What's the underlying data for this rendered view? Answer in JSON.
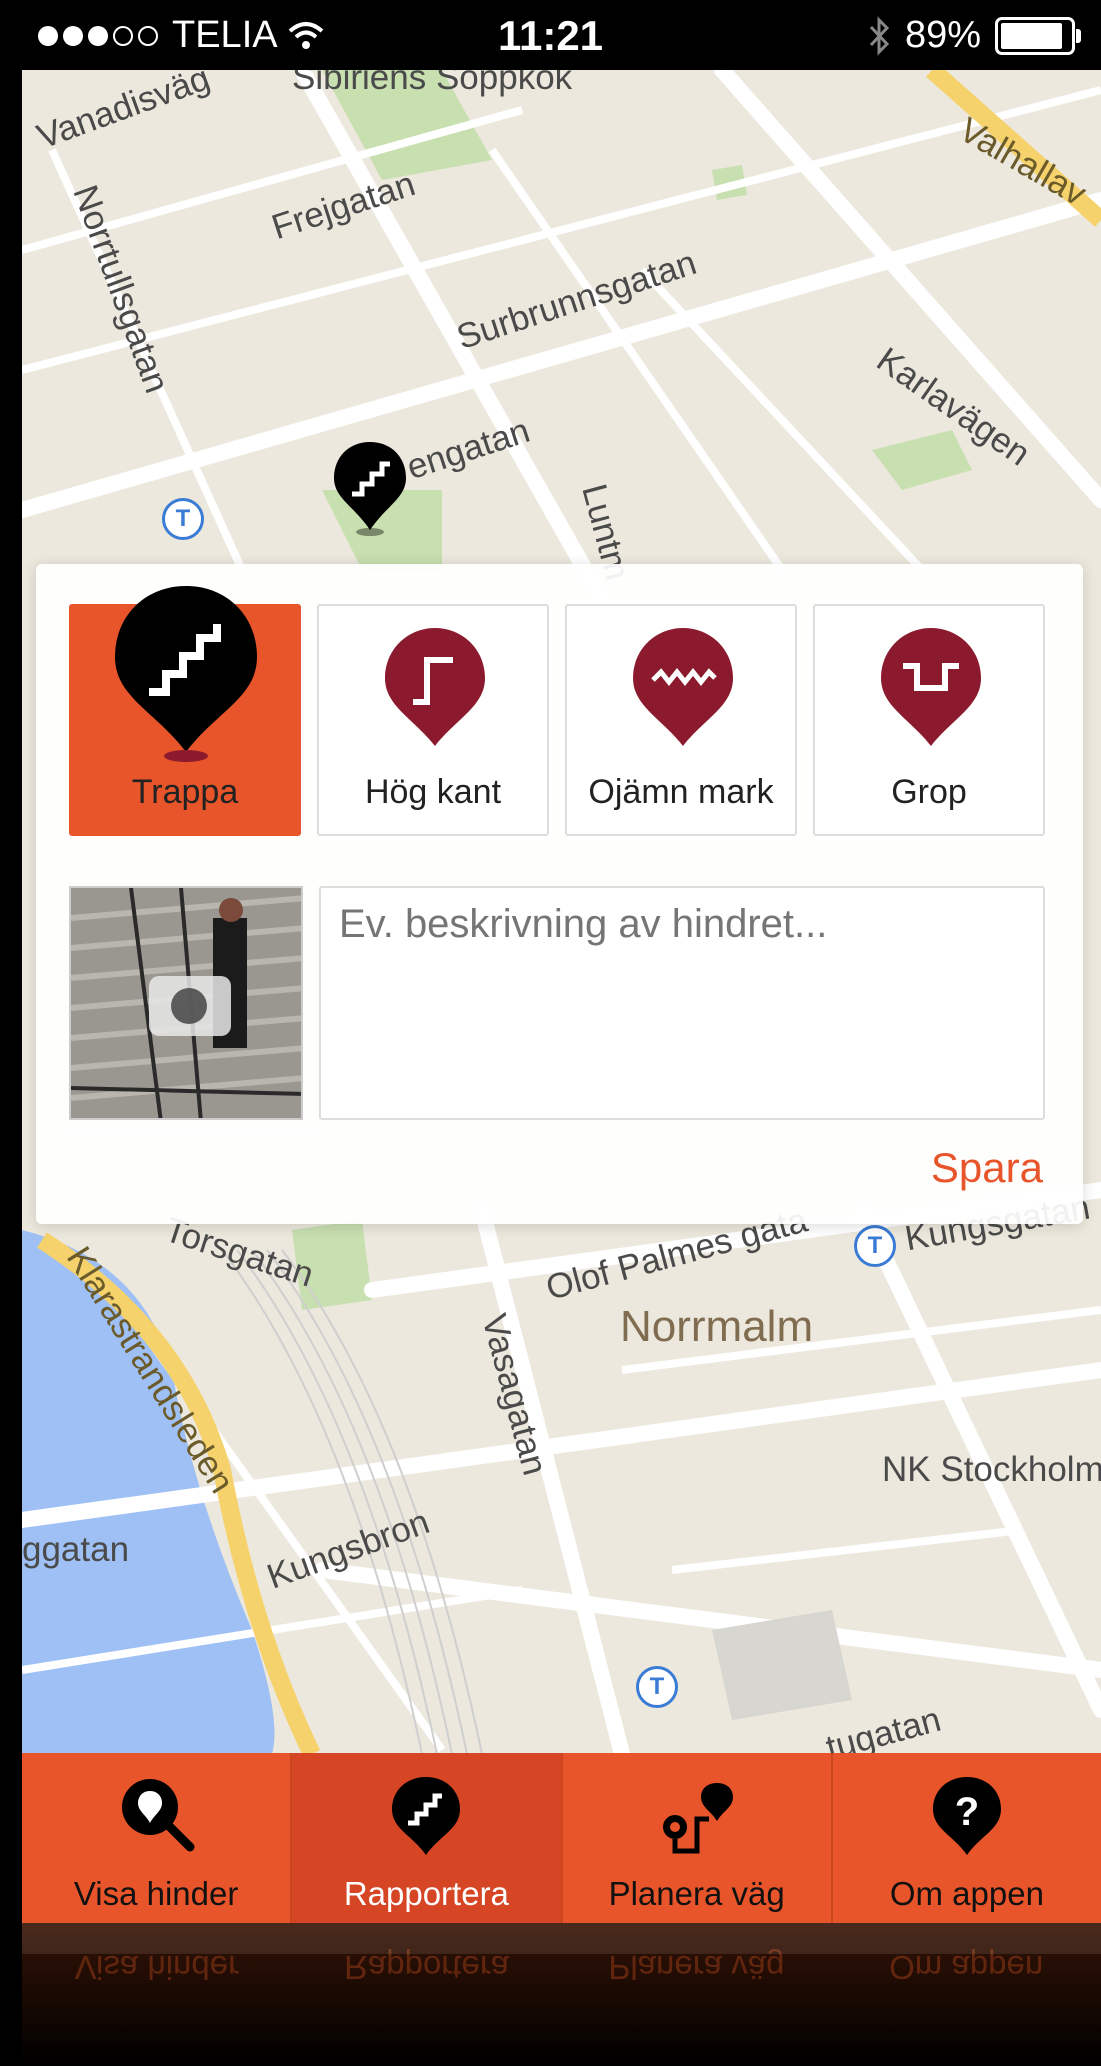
{
  "status_bar": {
    "carrier": "TELIA",
    "time": "11:21",
    "battery": "89%",
    "battery_level": 0.89
  },
  "map": {
    "streets": [
      "Vanadisväg",
      "Sibiriens Soppkök",
      "Frejgatan",
      "Norrtullsgatan",
      "Surbrunnsgatan",
      "Karlavägen",
      "engatan",
      "Luntm",
      "Torsgatan",
      "Olof Palmes gata",
      "Vasagatan",
      "Klarastrandsleden",
      "Kungsbron",
      "ggatan",
      "tugatan",
      "Kungsgatan",
      "NK Stockholm",
      "Valhallav"
    ],
    "district": "Norrmalm"
  },
  "report_panel": {
    "types": [
      {
        "label": "Trappa",
        "icon": "stairs-icon",
        "selected": true
      },
      {
        "label": "Hög kant",
        "icon": "high-curb-icon",
        "selected": false
      },
      {
        "label": "Ojämn mark",
        "icon": "uneven-ground-icon",
        "selected": false
      },
      {
        "label": "Grop",
        "icon": "pit-icon",
        "selected": false
      }
    ],
    "description_placeholder": "Ev. beskrivning av hindret...",
    "save_label": "Spara"
  },
  "tabs": [
    {
      "label": "Visa hinder",
      "icon": "search-pin-icon",
      "active": false
    },
    {
      "label": "Rapportera",
      "icon": "stairs-pin-icon",
      "active": true
    },
    {
      "label": "Planera väg",
      "icon": "route-icon",
      "active": false
    },
    {
      "label": "Om appen",
      "icon": "help-icon",
      "active": false
    }
  ],
  "colors": {
    "accent": "#e8552a",
    "marker_dark": "#8b1a2e",
    "map_bg": "#ece8dd"
  }
}
